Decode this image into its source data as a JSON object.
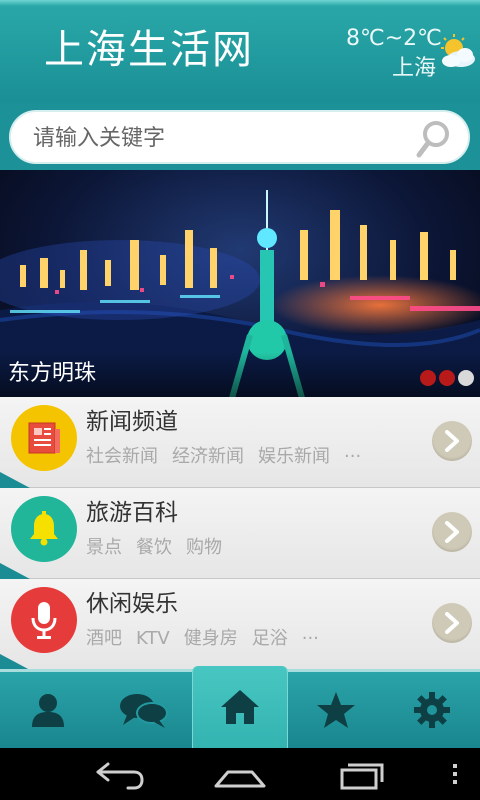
{
  "header": {
    "app_title": "上海生活网",
    "weather_temp": "8℃~2℃",
    "weather_city": "上海",
    "weather_icon": "sun-cloud-icon"
  },
  "search": {
    "placeholder": "请输入关键字",
    "icon": "search-icon"
  },
  "banner": {
    "caption": "东方明珠",
    "dots": [
      {
        "color": "#b81a1a",
        "active": true
      },
      {
        "color": "#b81a1a",
        "active": true
      },
      {
        "color": "#d9d9d9",
        "active": false
      }
    ]
  },
  "categories": [
    {
      "title": "新闻频道",
      "tags": [
        "社会新闻",
        "经济新闻",
        "娱乐新闻",
        "···"
      ],
      "icon": "newspaper-icon",
      "color": "#f5c400"
    },
    {
      "title": "旅游百科",
      "tags": [
        "景点",
        "餐饮",
        "购物"
      ],
      "icon": "bell-icon",
      "color": "#21b59a"
    },
    {
      "title": "休闲娱乐",
      "tags": [
        "酒吧",
        "KTV",
        "健身房",
        "足浴",
        "···"
      ],
      "icon": "microphone-icon",
      "color": "#e63b3b"
    }
  ],
  "tabs": [
    {
      "name": "profile",
      "icon": "user-icon",
      "active": false
    },
    {
      "name": "messages",
      "icon": "chat-icon",
      "active": false
    },
    {
      "name": "home",
      "icon": "home-icon",
      "active": true
    },
    {
      "name": "favorites",
      "icon": "star-icon",
      "active": false
    },
    {
      "name": "settings",
      "icon": "gear-icon",
      "active": false
    }
  ],
  "system_nav": [
    "back-icon",
    "home-nav-icon",
    "recents-icon",
    "overflow-menu-icon"
  ],
  "colors": {
    "teal": "#1a8f96",
    "accent_active_tab": "#3dbdb8"
  }
}
